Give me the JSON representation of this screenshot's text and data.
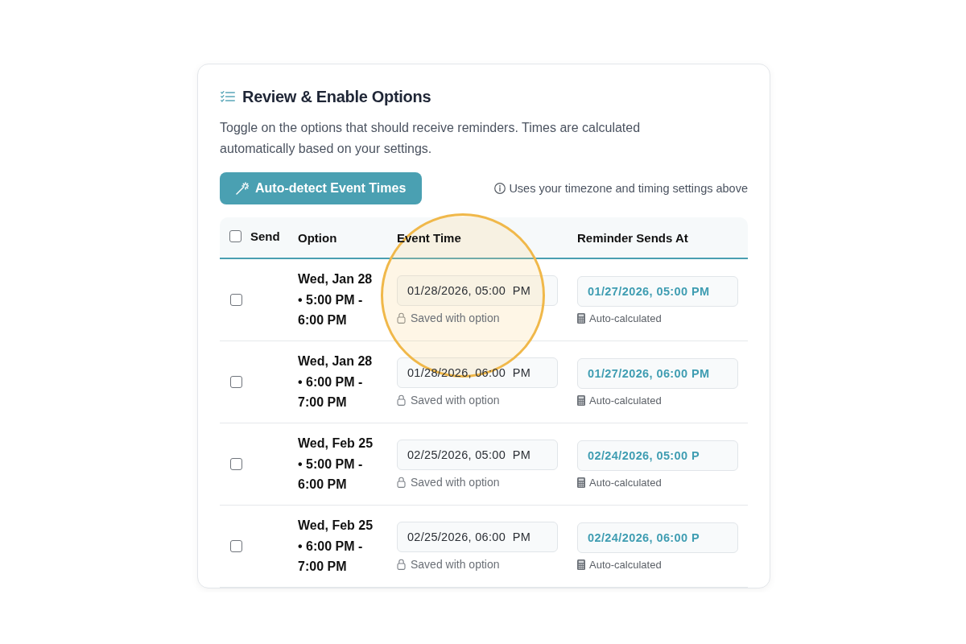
{
  "section": {
    "title": "Review & Enable Options",
    "description": "Toggle on the options that should receive reminders. Times are calculated automatically based on your settings."
  },
  "auto_detect_button": {
    "label": "Auto-detect Event Times"
  },
  "hint": "Uses your timezone and timing settings above",
  "table": {
    "columns": [
      {
        "label": "Send",
        "kind": "checkbox",
        "checked": false
      },
      {
        "label": "Option",
        "kind": "text"
      },
      {
        "label": "Event Time",
        "kind": "text"
      },
      {
        "label": "Reminder Sends At",
        "kind": "text"
      }
    ],
    "rows": [
      {
        "checked": false,
        "option": "Wed, Jan 28 • 5:00 PM - 6:00 PM",
        "event_time": "01/28/2026, 05:00  PM",
        "event_note": "Saved with option",
        "reminder_time": "01/27/2026, 05:00 PM",
        "reminder_note": "Auto-calculated",
        "highlighted": true
      },
      {
        "checked": false,
        "option": "Wed, Jan 28 • 6:00 PM - 7:00 PM",
        "event_time": "01/28/2026, 06:00  PM",
        "event_note": "Saved with option",
        "reminder_time": "01/27/2026, 06:00 PM",
        "reminder_note": "Auto-calculated",
        "highlighted": false
      },
      {
        "checked": false,
        "option": "Wed, Feb 25 • 5:00 PM - 6:00 PM",
        "event_time": "02/25/2026, 05:00  PM",
        "event_note": "Saved with option",
        "reminder_time": "02/24/2026, 05:00 P",
        "reminder_note": "Auto-calculated",
        "highlighted": false
      },
      {
        "checked": false,
        "option": "Wed, Feb 25 • 6:00 PM - 7:00 PM",
        "event_time": "02/25/2026, 06:00  PM",
        "event_note": "Saved with option",
        "reminder_time": "02/24/2026, 06:00 P",
        "reminder_note": "Auto-calculated",
        "highlighted": false
      }
    ]
  }
}
